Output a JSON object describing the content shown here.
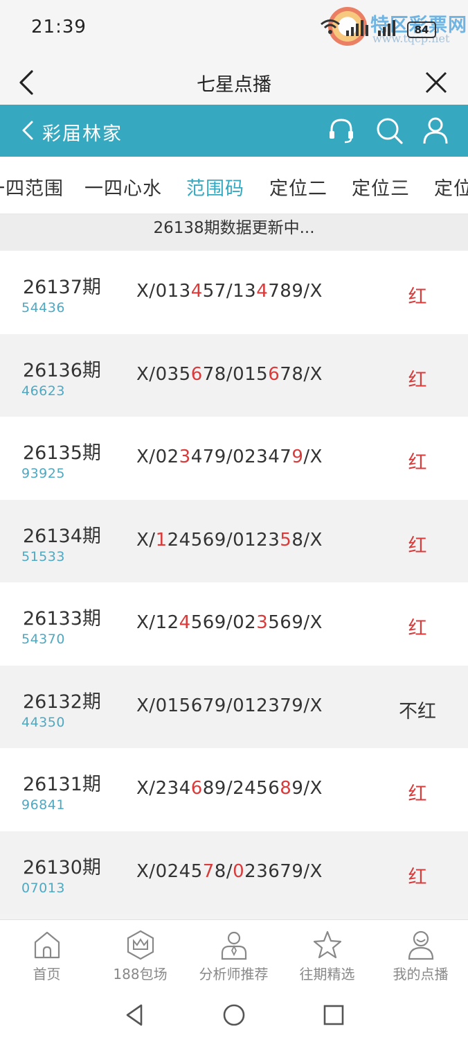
{
  "status": {
    "time": "21:39",
    "battery": "84",
    "watermark_text": "特区彩票网",
    "watermark_url": "www.tqcp.net"
  },
  "title_bar": {
    "title": "七星点播"
  },
  "header": {
    "back_label": "彩届林家"
  },
  "tabs": [
    "一四范围",
    "一四心水",
    "范围码",
    "定位二",
    "定位三",
    "定位"
  ],
  "active_tab": "范围码",
  "notice": "26138期数据更新中...",
  "rows": [
    {
      "period": "26137期",
      "draw": "54436",
      "segments": [
        {
          "t": "X/013"
        },
        {
          "t": "4",
          "hl": true
        },
        {
          "t": "57/13"
        },
        {
          "t": "4",
          "hl": true
        },
        {
          "t": "789/X"
        }
      ],
      "result": "红",
      "hit": true
    },
    {
      "period": "26136期",
      "draw": "46623",
      "segments": [
        {
          "t": "X/035"
        },
        {
          "t": "6",
          "hl": true
        },
        {
          "t": "78/015"
        },
        {
          "t": "6",
          "hl": true
        },
        {
          "t": "78/X"
        }
      ],
      "result": "红",
      "hit": true
    },
    {
      "period": "26135期",
      "draw": "93925",
      "segments": [
        {
          "t": "X/02"
        },
        {
          "t": "3",
          "hl": true
        },
        {
          "t": "479/02347"
        },
        {
          "t": "9",
          "hl": true
        },
        {
          "t": "/X"
        }
      ],
      "result": "红",
      "hit": true
    },
    {
      "period": "26134期",
      "draw": "51533",
      "segments": [
        {
          "t": "X/"
        },
        {
          "t": "1",
          "hl": true
        },
        {
          "t": "24569/0123"
        },
        {
          "t": "5",
          "hl": true
        },
        {
          "t": "8/X"
        }
      ],
      "result": "红",
      "hit": true
    },
    {
      "period": "26133期",
      "draw": "54370",
      "segments": [
        {
          "t": "X/12"
        },
        {
          "t": "4",
          "hl": true
        },
        {
          "t": "569/02"
        },
        {
          "t": "3",
          "hl": true
        },
        {
          "t": "569/X"
        }
      ],
      "result": "红",
      "hit": true
    },
    {
      "period": "26132期",
      "draw": "44350",
      "segments": [
        {
          "t": "X/015679/012379/X"
        }
      ],
      "result": "不红",
      "hit": false
    },
    {
      "period": "26131期",
      "draw": "96841",
      "segments": [
        {
          "t": "X/234"
        },
        {
          "t": "6",
          "hl": true
        },
        {
          "t": "89/2456"
        },
        {
          "t": "8",
          "hl": true
        },
        {
          "t": "9/X"
        }
      ],
      "result": "红",
      "hit": true
    },
    {
      "period": "26130期",
      "draw": "07013",
      "segments": [
        {
          "t": "X/0245"
        },
        {
          "t": "7",
          "hl": true
        },
        {
          "t": "8/"
        },
        {
          "t": "0",
          "hl": true
        },
        {
          "t": "23679/X"
        }
      ],
      "result": "红",
      "hit": true
    }
  ],
  "bottom_nav": [
    {
      "label": "首页",
      "icon": "home-icon"
    },
    {
      "label": "188包场",
      "icon": "crown-icon"
    },
    {
      "label": "分析师推荐",
      "icon": "analyst-icon"
    },
    {
      "label": "往期精选",
      "icon": "star-icon"
    },
    {
      "label": "我的点播",
      "icon": "user-icon"
    }
  ],
  "colors": {
    "accent": "#36a8bf",
    "hit": "#d93a3a",
    "draw_number": "#4ea8c2"
  }
}
